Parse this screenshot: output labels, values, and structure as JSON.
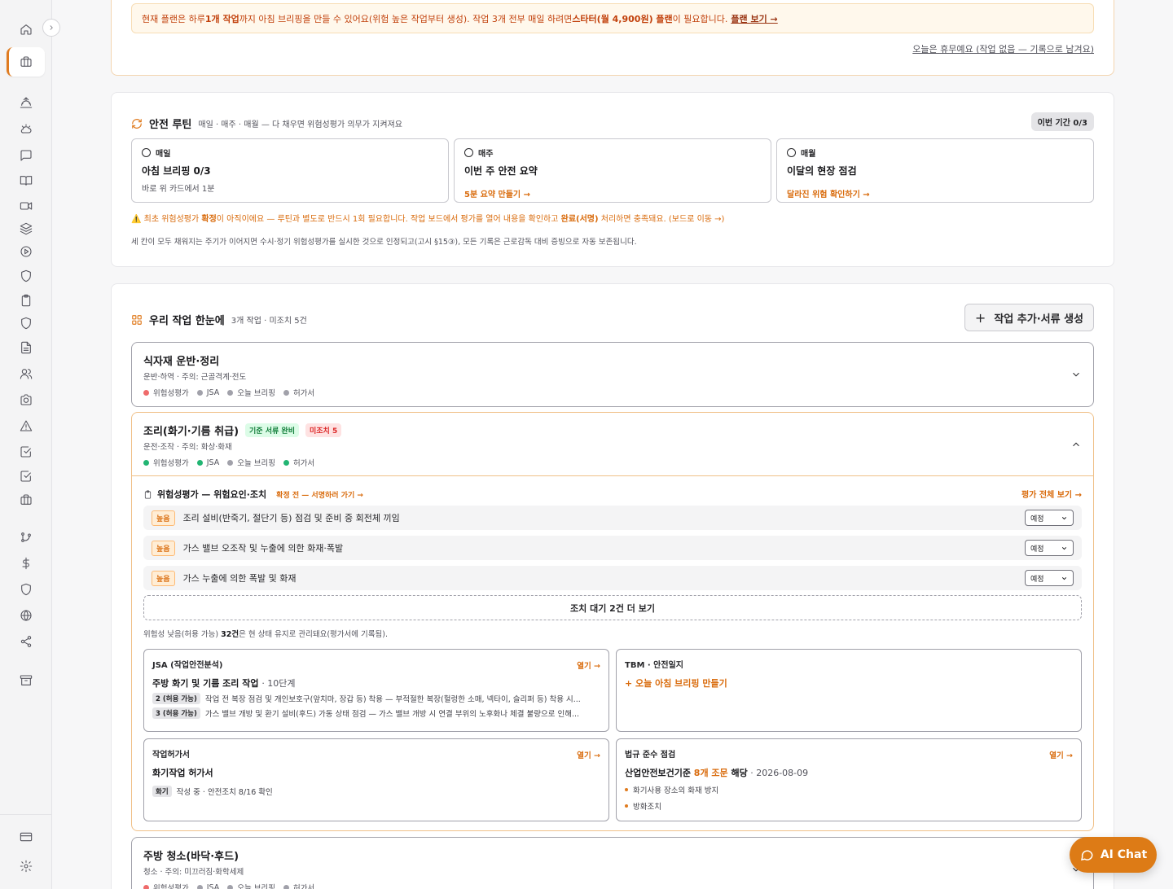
{
  "notice": {
    "pre": "현재 플랜은 하루 ",
    "bold1": "1개 작업",
    "mid": "까지 아침 브리핑을 만들 수 있어요(위험 높은 작업부터 생성). 작업 3개 전부 매일 하려면 ",
    "bold2": "스타터(월 4,900원) 플랜",
    "post": "이 필요합니다.",
    "link": "플랜 보기 →"
  },
  "rest_link": "오늘은 휴무예요 (작업 없음 — 기록으로 남겨요)",
  "routine": {
    "title": "안전 루틴",
    "subtitle": "매일 · 매주 · 매월 — 다 채우면 위험성평가 의무가 지켜져요",
    "badge": "이번 기간 0/3",
    "boxes": [
      {
        "freq": "매일",
        "title": "아침 브리핑 0/3",
        "desc": "바로 위 카드에서 1분"
      },
      {
        "freq": "매주",
        "title": "이번 주 안전 요약",
        "link": "5분 요약 만들기 →"
      },
      {
        "freq": "매월",
        "title": "이달의 현장 점검",
        "link": "달라진 위험 확인하기 →"
      }
    ],
    "warn": {
      "p1": "⚠️ 최초 위험성평가 ",
      "b1": "확정",
      "p2": "이 아직이에요 — 루틴과 별도로 반드시 1회 필요합니다. 작업 보드에서 평가를 열어 내용을 확인하고 ",
      "b2": "완료(서명)",
      "p3": " 처리하면 충족돼요. (보드로 이동 →)"
    },
    "note": "세 칸이 모두 채워지는 주기가 이어지면 수시·정기 위험성평가를 실시한 것으로 인정되고(고시 §15③), 모든 기록은 근로감독 대비 증빙으로 자동 보존됩니다."
  },
  "jobs": {
    "title": "우리 작업 한눈에",
    "subtitle": "3개 작업 · 미조치 5건",
    "add_button": "작업 추가·서류 생성",
    "doc_labels": [
      "위험성평가",
      "JSA",
      "오늘 브리핑",
      "허가서"
    ],
    "items": [
      {
        "name": "식자재 운반·정리",
        "meta": "운반·하역 · 주의: 근골격계·전도"
      },
      {
        "name": "조리(화기·기름 취급)",
        "meta": "운전·조작 · 주의: 화상·화재",
        "tag_ok": "기준 서류 완비",
        "tag_issue": "미조치 5"
      },
      {
        "name": "주방 청소(바닥·후드)",
        "meta": "청소 · 주의: 미끄러짐·화학세제"
      }
    ],
    "colors": {
      "red": "#ef6b6b",
      "gray": "#a1a1aa",
      "green": "#22b573"
    }
  },
  "assessment": {
    "title": "위험성평가 — 위험요인·조치",
    "confirm": "확정 전 — 서명하러 가기 →",
    "view_all": "평가 전체 보기 →",
    "hazards": [
      {
        "level": "높음",
        "text": "조리 설비(반죽기, 절단기 등) 점검 및 준비 중 회전체 끼임",
        "status": "예정"
      },
      {
        "level": "높음",
        "text": "가스 밸브 오조작 및 누출에 의한 화재·폭발",
        "status": "예정"
      },
      {
        "level": "높음",
        "text": "가스 누출에 의한 폭발 및 화재",
        "status": "예정"
      }
    ],
    "more": "조치 대기 2건 더 보기",
    "low_pre": "위험성 낮음(허용 가능) ",
    "low_count": "32건",
    "low_post": "은 현 상태 유지로 관리돼요(평가서에 기록됨)."
  },
  "jsa": {
    "label": "JSA (작업안전분석)",
    "open": "열기 →",
    "title": "주방 화기 및 기름 조리 작업",
    "steps": "· 10단계",
    "lines": [
      {
        "badge": "2 (허용 가능)",
        "text": "작업 전 복장 점검 및 개인보호구(앞치마, 장갑 등) 착용 — 부적절한 복장(헐렁한 소매, 넥타이, 슬리퍼 등) 착용 시..."
      },
      {
        "badge": "3 (허용 가능)",
        "text": "가스 밸브 개방 및 환기 설비(후드) 가동 상태 점검 — 가스 밸브 개방 시 연결 부위의 노후화나 체결 불량으로 인해..."
      }
    ]
  },
  "tbm": {
    "label": "TBM · 안전일지",
    "cta": "+ 오늘 아침 브리핑 만들기"
  },
  "permit": {
    "label": "작업허가서",
    "open": "열기 →",
    "title": "화기작업 허가서",
    "badge": "화기",
    "status": "작성 중 · 안전조치 8/16 확인"
  },
  "law": {
    "label": "법규 준수 점검",
    "open": "열기 →",
    "pre": "산업안전보건기준 ",
    "count": "8개 조문",
    "post": " 해당",
    "date": " · 2026-08-09",
    "items": [
      "화기사용 장소의 화재 방지",
      "방화조치"
    ]
  },
  "ai_chat": "AI Chat"
}
